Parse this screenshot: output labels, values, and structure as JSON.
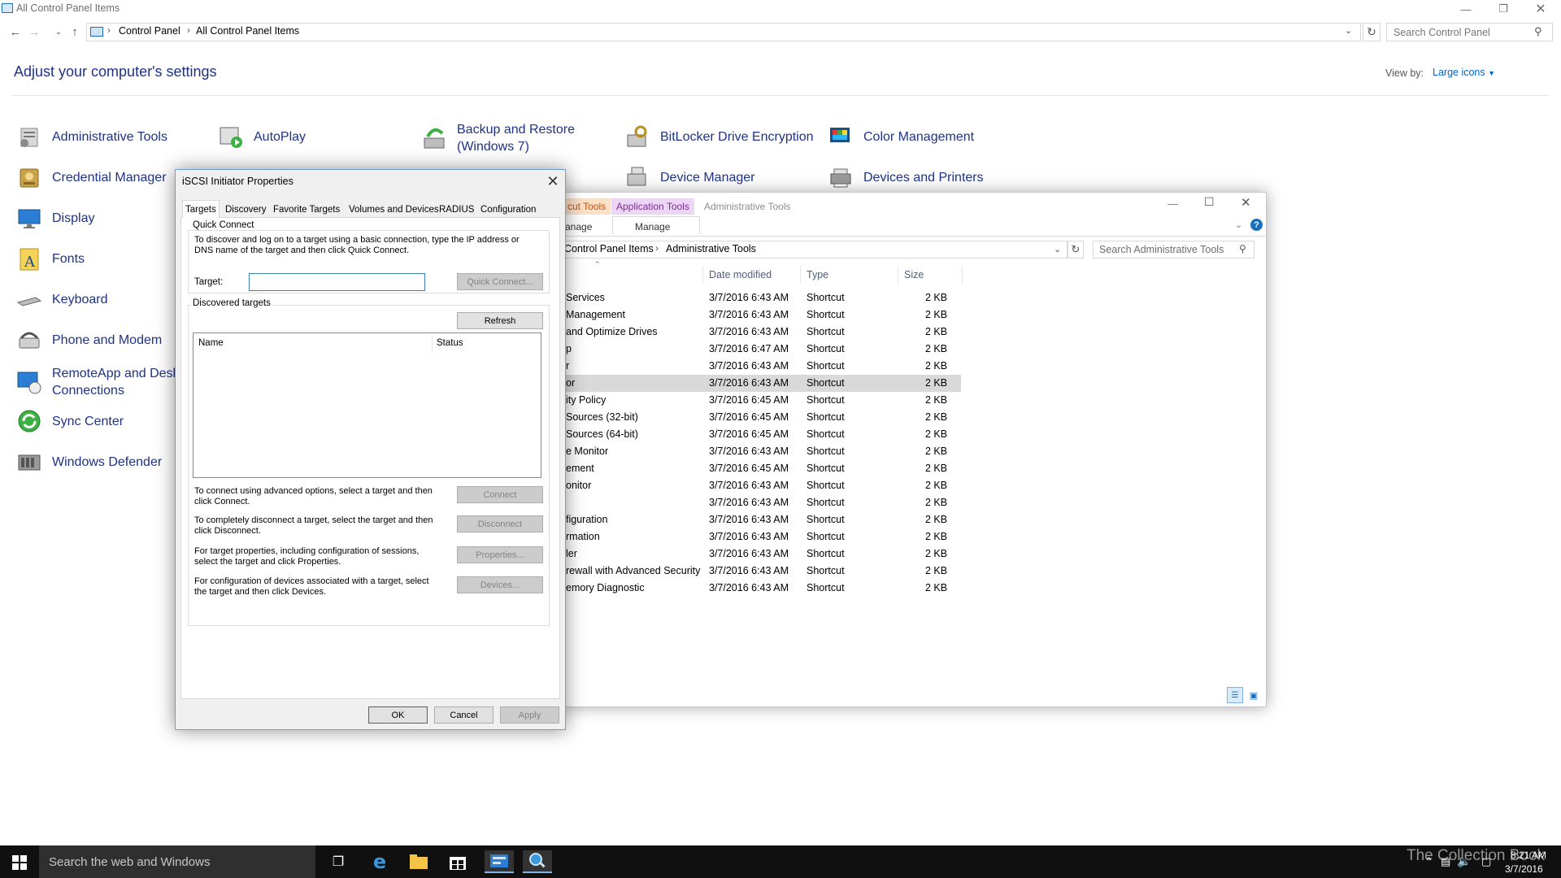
{
  "control_panel": {
    "window_title": "All Control Panel Items",
    "breadcrumb": [
      "Control Panel",
      "All Control Panel Items"
    ],
    "search_placeholder": "Search Control Panel",
    "heading": "Adjust your computer's settings",
    "view_by_label": "View by:",
    "view_by_value": "Large icons",
    "items": [
      {
        "label": "Administrative Tools",
        "icon": "administrative-tools-icon"
      },
      {
        "label": "AutoPlay",
        "icon": "autoplay-icon"
      },
      {
        "label": "Backup and Restore (Windows 7)",
        "icon": "backup-restore-icon"
      },
      {
        "label": "BitLocker Drive Encryption",
        "icon": "bitlocker-icon"
      },
      {
        "label": "Color Management",
        "icon": "color-management-icon"
      },
      {
        "label": "Credential Manager",
        "icon": "credential-manager-icon"
      },
      {
        "label": "Device Manager",
        "icon": "device-manager-icon"
      },
      {
        "label": "Devices and Printers",
        "icon": "devices-printers-icon"
      },
      {
        "label": "Display",
        "icon": "display-icon"
      },
      {
        "label": "Fonts",
        "icon": "fonts-icon"
      },
      {
        "label": "Keyboard",
        "icon": "keyboard-icon"
      },
      {
        "label": "Phone and Modem",
        "icon": "phone-modem-icon"
      },
      {
        "label": "RemoteApp and Deskt",
        "label2": "Connections",
        "icon": "remoteapp-icon"
      },
      {
        "label": "Sync Center",
        "icon": "sync-center-icon"
      },
      {
        "label": "Windows Defender",
        "icon": "windows-defender-icon"
      }
    ]
  },
  "admin_tools": {
    "ribbon_tabs": [
      "cut Tools",
      "Application Tools",
      "Administrative Tools"
    ],
    "ribbon_sub": [
      "anage",
      "Manage"
    ],
    "breadcrumb": [
      "Control Panel Items",
      "Administrative Tools"
    ],
    "search_placeholder": "Search Administrative Tools",
    "columns": [
      "Date modified",
      "Type",
      "Size"
    ],
    "files": [
      {
        "name": "Services",
        "date": "3/7/2016 6:43 AM",
        "type": "Shortcut",
        "size": "2 KB"
      },
      {
        "name": "Management",
        "date": "3/7/2016 6:43 AM",
        "type": "Shortcut",
        "size": "2 KB"
      },
      {
        "name": "and Optimize Drives",
        "date": "3/7/2016 6:43 AM",
        "type": "Shortcut",
        "size": "2 KB"
      },
      {
        "name": "p",
        "date": "3/7/2016 6:47 AM",
        "type": "Shortcut",
        "size": "2 KB"
      },
      {
        "name": "r",
        "date": "3/7/2016 6:43 AM",
        "type": "Shortcut",
        "size": "2 KB"
      },
      {
        "name": "or",
        "date": "3/7/2016 6:43 AM",
        "type": "Shortcut",
        "size": "2 KB",
        "selected": "true"
      },
      {
        "name": "ity Policy",
        "date": "3/7/2016 6:45 AM",
        "type": "Shortcut",
        "size": "2 KB"
      },
      {
        "name": "Sources (32-bit)",
        "date": "3/7/2016 6:45 AM",
        "type": "Shortcut",
        "size": "2 KB"
      },
      {
        "name": "Sources (64-bit)",
        "date": "3/7/2016 6:45 AM",
        "type": "Shortcut",
        "size": "2 KB"
      },
      {
        "name": "e Monitor",
        "date": "3/7/2016 6:43 AM",
        "type": "Shortcut",
        "size": "2 KB"
      },
      {
        "name": "ement",
        "date": "3/7/2016 6:45 AM",
        "type": "Shortcut",
        "size": "2 KB"
      },
      {
        "name": "onitor",
        "date": "3/7/2016 6:43 AM",
        "type": "Shortcut",
        "size": "2 KB"
      },
      {
        "name": "",
        "date": "3/7/2016 6:43 AM",
        "type": "Shortcut",
        "size": "2 KB"
      },
      {
        "name": "figuration",
        "date": "3/7/2016 6:43 AM",
        "type": "Shortcut",
        "size": "2 KB"
      },
      {
        "name": "rmation",
        "date": "3/7/2016 6:43 AM",
        "type": "Shortcut",
        "size": "2 KB"
      },
      {
        "name": "ler",
        "date": "3/7/2016 6:43 AM",
        "type": "Shortcut",
        "size": "2 KB"
      },
      {
        "name": "rewall with Advanced Security",
        "date": "3/7/2016 6:43 AM",
        "type": "Shortcut",
        "size": "2 KB"
      },
      {
        "name": "emory Diagnostic",
        "date": "3/7/2016 6:43 AM",
        "type": "Shortcut",
        "size": "2 KB"
      }
    ]
  },
  "iscsi": {
    "title": "iSCSI Initiator Properties",
    "tabs": [
      "Targets",
      "Discovery",
      "Favorite Targets",
      "Volumes and Devices",
      "RADIUS",
      "Configuration"
    ],
    "quick_connect_label": "Quick Connect",
    "quick_connect_text": "To discover and log on to a target using a basic connection, type the IP address or DNS name of the target and then click Quick Connect.",
    "target_label": "Target:",
    "target_value": "",
    "quick_connect_button": "Quick Connect...",
    "discovered_label": "Discovered targets",
    "refresh_button": "Refresh",
    "list_columns": [
      "Name",
      "Status"
    ],
    "actions": [
      {
        "text": "To connect using advanced options, select a target and then click Connect.",
        "button": "Connect"
      },
      {
        "text": "To completely disconnect a target, select the target and then click Disconnect.",
        "button": "Disconnect"
      },
      {
        "text": "For target properties, including configuration of sessions, select the target and click Properties.",
        "button": "Properties..."
      },
      {
        "text": "For configuration of devices associated with a target, select the target and then click Devices.",
        "button": "Devices..."
      }
    ],
    "ok_button": "OK",
    "cancel_button": "Cancel",
    "apply_button": "Apply"
  },
  "taskbar": {
    "search_text": "Search the web and Windows",
    "time": "8:21 AM",
    "date": "3/7/2016",
    "watermark": "The Collection Book"
  }
}
